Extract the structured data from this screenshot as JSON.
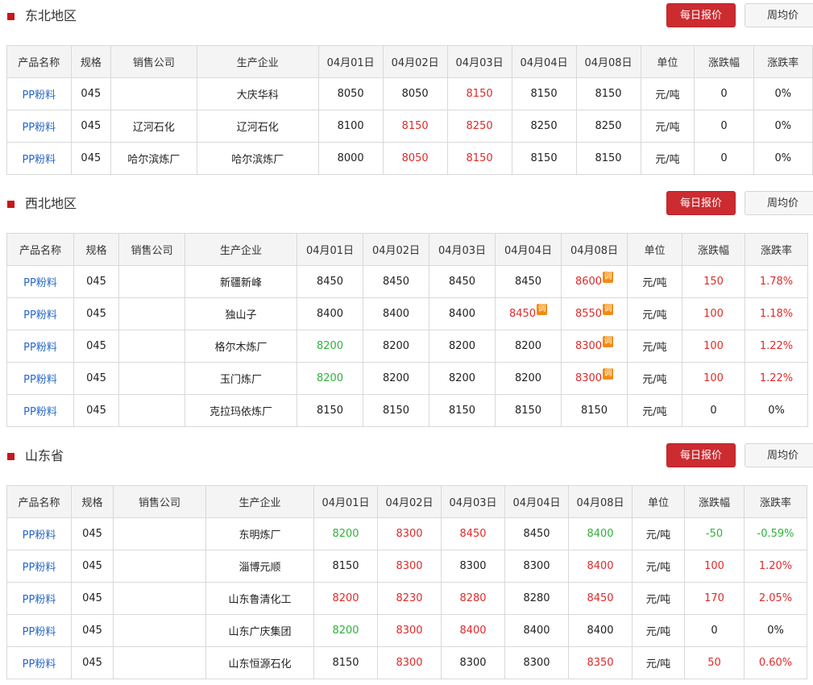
{
  "accent_color": "#cc2b30",
  "up_color": "#e02a2a",
  "down_color": "#2fb23a",
  "regions": [
    {
      "title": "东北地区",
      "daily_button": "每日报价",
      "weekly_button": "周均价",
      "headers": [
        "产品名称",
        "规格",
        "销售公司",
        "生产企业",
        "04月01日",
        "04月02日",
        "04月03日",
        "04月04日",
        "04月08日",
        "单位",
        "涨跌幅",
        "涨跌率"
      ],
      "rows": [
        [
          "PP粉料",
          "045",
          "",
          "大庆华科",
          "8050",
          "8050",
          "8150",
          "8150",
          "8150",
          "元/吨",
          "0",
          "0%"
        ],
        [
          "PP粉料",
          "045",
          "辽河石化",
          "辽河石化",
          "8100",
          "8150",
          "8250",
          "8250",
          "8250",
          "元/吨",
          "0",
          "0%"
        ],
        [
          "PP粉料",
          "045",
          "哈尔滨炼厂",
          "哈尔滨炼厂",
          "8000",
          "8050",
          "8150",
          "8150",
          "8150",
          "元/吨",
          "0",
          "0%"
        ]
      ],
      "row_colors": [
        [
          "",
          "",
          "",
          "",
          "",
          "",
          "up",
          "",
          "",
          "",
          "",
          ""
        ],
        [
          "",
          "",
          "",
          "",
          "",
          "up",
          "up",
          "",
          "",
          "",
          "",
          ""
        ],
        [
          "",
          "",
          "",
          "",
          "",
          "up",
          "up",
          "",
          "",
          "",
          "",
          ""
        ]
      ],
      "adjusted": [
        [],
        [],
        []
      ]
    },
    {
      "title": "西北地区",
      "daily_button": "每日报价",
      "weekly_button": "周均价",
      "headers": [
        "产品名称",
        "规格",
        "销售公司",
        "生产企业",
        "04月01日",
        "04月02日",
        "04月03日",
        "04月04日",
        "04月08日",
        "单位",
        "涨跌幅",
        "涨跌率"
      ],
      "rows": [
        [
          "PP粉料",
          "045",
          "",
          "新疆新峰",
          "8450",
          "8450",
          "8450",
          "8450",
          "8600",
          "元/吨",
          "150",
          "1.78%"
        ],
        [
          "PP粉料",
          "045",
          "",
          "独山子",
          "8400",
          "8400",
          "8400",
          "8450",
          "8550",
          "元/吨",
          "100",
          "1.18%"
        ],
        [
          "PP粉料",
          "045",
          "",
          "格尔木炼厂",
          "8200",
          "8200",
          "8200",
          "8200",
          "8300",
          "元/吨",
          "100",
          "1.22%"
        ],
        [
          "PP粉料",
          "045",
          "",
          "玉门炼厂",
          "8200",
          "8200",
          "8200",
          "8200",
          "8300",
          "元/吨",
          "100",
          "1.22%"
        ],
        [
          "PP粉料",
          "045",
          "",
          "克拉玛依炼厂",
          "8150",
          "8150",
          "8150",
          "8150",
          "8150",
          "元/吨",
          "0",
          "0%"
        ]
      ],
      "row_colors": [
        [
          "",
          "",
          "",
          "",
          "",
          "",
          "",
          "",
          "up",
          "",
          "up",
          "up"
        ],
        [
          "",
          "",
          "",
          "",
          "",
          "",
          "",
          "up",
          "up",
          "",
          "up",
          "up"
        ],
        [
          "",
          "",
          "",
          "",
          "down",
          "",
          "",
          "",
          "up",
          "",
          "up",
          "up"
        ],
        [
          "",
          "",
          "",
          "",
          "down",
          "",
          "",
          "",
          "up",
          "",
          "up",
          "up"
        ],
        [
          "",
          "",
          "",
          "",
          "",
          "",
          "",
          "",
          "",
          "",
          "",
          ""
        ]
      ],
      "adjusted": [
        [
          8
        ],
        [
          7,
          8
        ],
        [
          8
        ],
        [
          8
        ],
        []
      ],
      "adjust_label": "调"
    },
    {
      "title": "山东省",
      "daily_button": "每日报价",
      "weekly_button": "周均价",
      "headers": [
        "产品名称",
        "规格",
        "销售公司",
        "生产企业",
        "04月01日",
        "04月02日",
        "04月03日",
        "04月04日",
        "04月08日",
        "单位",
        "涨跌幅",
        "涨跌率"
      ],
      "rows": [
        [
          "PP粉料",
          "045",
          "",
          "东明炼厂",
          "8200",
          "8300",
          "8450",
          "8450",
          "8400",
          "元/吨",
          "-50",
          "-0.59%"
        ],
        [
          "PP粉料",
          "045",
          "",
          "淄博元顺",
          "8150",
          "8300",
          "8300",
          "8300",
          "8400",
          "元/吨",
          "100",
          "1.20%"
        ],
        [
          "PP粉料",
          "045",
          "",
          "山东鲁清化工",
          "8200",
          "8230",
          "8280",
          "8280",
          "8450",
          "元/吨",
          "170",
          "2.05%"
        ],
        [
          "PP粉料",
          "045",
          "",
          "山东广庆集团",
          "8200",
          "8300",
          "8400",
          "8400",
          "8400",
          "元/吨",
          "0",
          "0%"
        ],
        [
          "PP粉料",
          "045",
          "",
          "山东恒源石化",
          "8150",
          "8300",
          "8300",
          "8300",
          "8350",
          "元/吨",
          "50",
          "0.60%"
        ]
      ],
      "row_colors": [
        [
          "",
          "",
          "",
          "",
          "down",
          "up",
          "up",
          "",
          "down",
          "",
          "down",
          "down"
        ],
        [
          "",
          "",
          "",
          "",
          "",
          "up",
          "",
          "",
          "up",
          "",
          "up",
          "up"
        ],
        [
          "",
          "",
          "",
          "",
          "up",
          "up",
          "up",
          "",
          "up",
          "",
          "up",
          "up"
        ],
        [
          "",
          "",
          "",
          "",
          "down",
          "up",
          "up",
          "",
          "",
          "",
          "",
          ""
        ],
        [
          "",
          "",
          "",
          "",
          "",
          "up",
          "",
          "",
          "up",
          "",
          "up",
          "up"
        ]
      ],
      "adjusted": [
        [],
        [],
        [],
        [],
        []
      ]
    }
  ]
}
